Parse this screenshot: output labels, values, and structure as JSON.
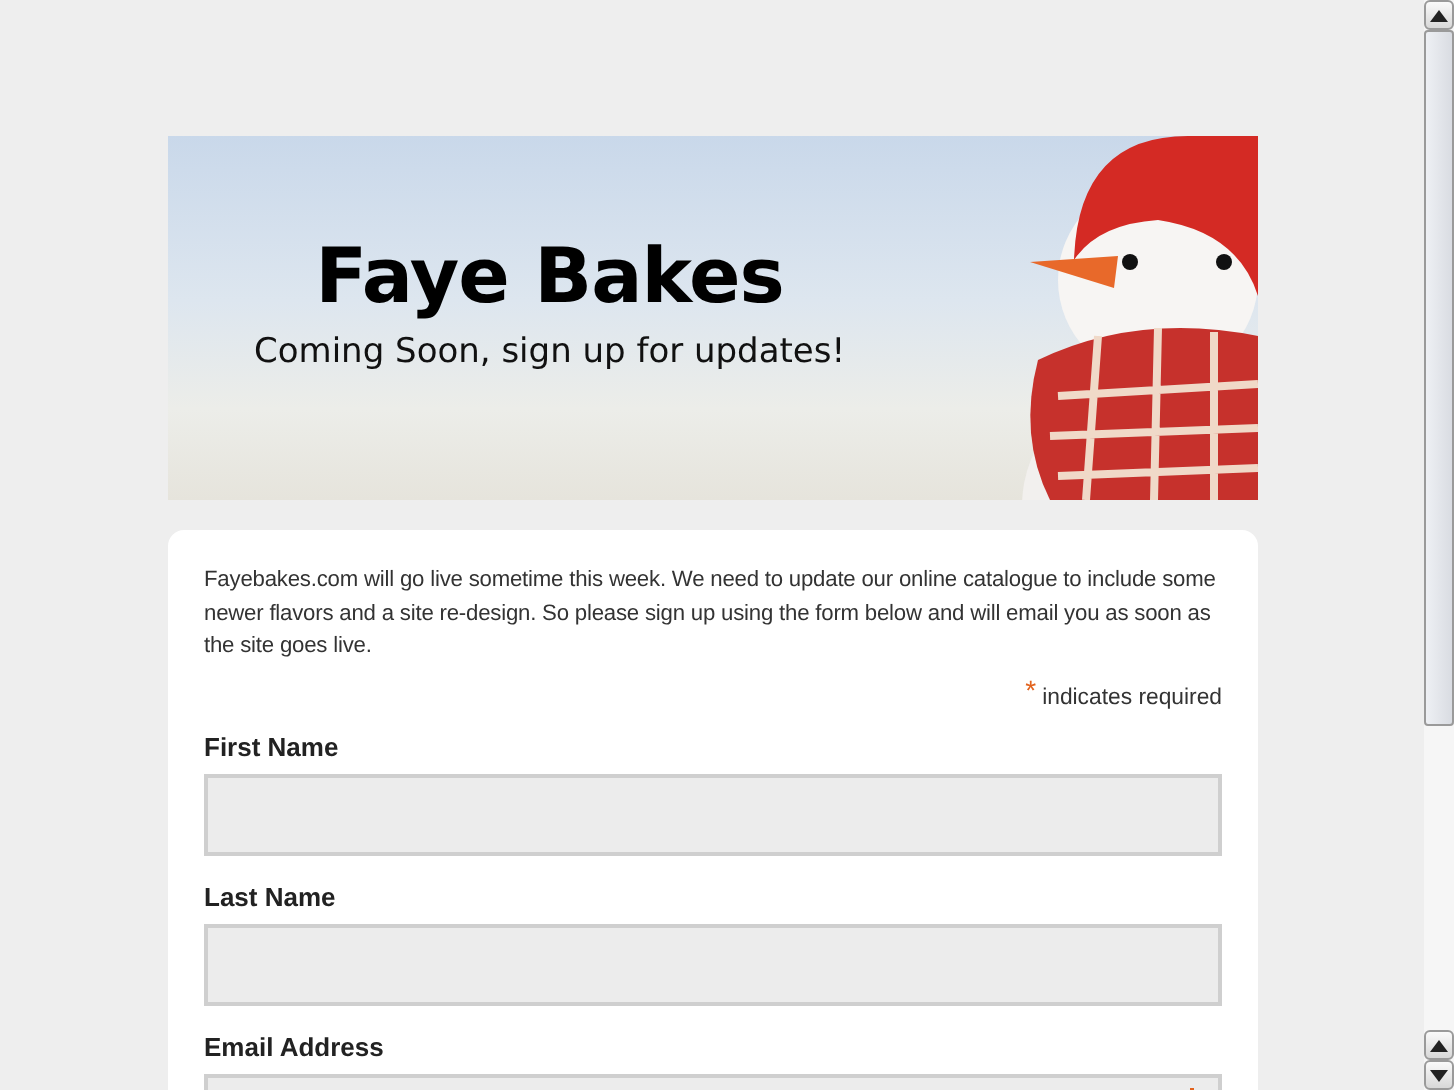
{
  "banner": {
    "title": "Faye Bakes",
    "tagline": "Coming Soon, sign up for updates!"
  },
  "intro": "Fayebakes.com  will go live sometime this week. We need to update our online catalogue to include some newer flavors and a site re-design. So please sign up using the form below and will email you as soon as the site goes live.",
  "required_note": {
    "mark": "*",
    "text": "indicates required"
  },
  "fields": [
    {
      "label": "First Name",
      "required": false
    },
    {
      "label": "Last Name",
      "required": false
    },
    {
      "label": "Email Address",
      "required": true
    }
  ]
}
